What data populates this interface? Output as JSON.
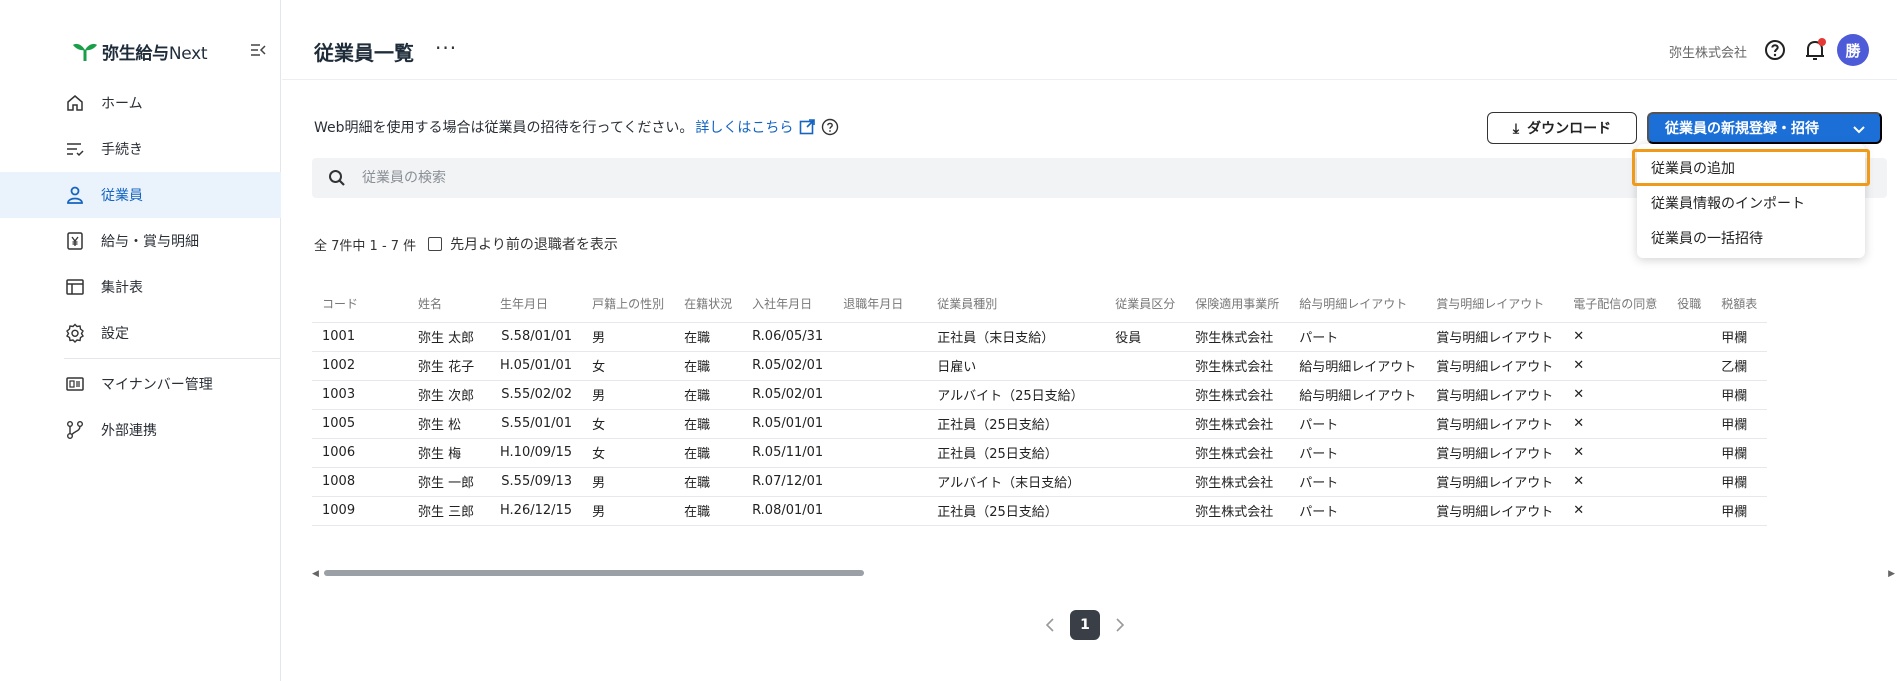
{
  "app": {
    "logo_text": "弥生給与",
    "logo_suffix": "Next",
    "colors": {
      "accent": "#1b6fd6",
      "active_bg": "#eaf2fb",
      "avatar": "#4d5bd8",
      "highlight": "#f09a1a"
    }
  },
  "sidebar": {
    "items": [
      {
        "label": "ホーム",
        "icon": "home-icon"
      },
      {
        "label": "手続き",
        "icon": "procedures-icon"
      },
      {
        "label": "従業員",
        "icon": "person-icon",
        "active": true
      },
      {
        "label": "給与・賞与明細",
        "icon": "yen-icon"
      },
      {
        "label": "集計表",
        "icon": "table-icon"
      },
      {
        "label": "設定",
        "icon": "gear-icon"
      },
      {
        "label": "マイナンバー管理",
        "icon": "id-card-icon"
      },
      {
        "label": "外部連携",
        "icon": "integration-icon"
      }
    ]
  },
  "header": {
    "title": "従業員一覧",
    "more": "···",
    "company": "弥生株式会社",
    "avatar_initial": "勝"
  },
  "main": {
    "notice_text": "Web明細を使用する場合は従業員の招待を行ってください。",
    "notice_link": "詳しくはこちら",
    "download_label": "ダウンロード",
    "register_label": "従業員の新規登録・招待",
    "search_placeholder": "従業員の検索",
    "count_text": "全 7件中 1 - 7 件",
    "show_retired_label": "先月より前の退職者を表示"
  },
  "table": {
    "columns": [
      "コード",
      "姓名",
      "生年月日",
      "戸籍上の性別",
      "在籍状況",
      "入社年月日",
      "退職年月日",
      "従業員種別",
      "従業員区分",
      "保険適用事業所",
      "給与明細レイアウト",
      "賞与明細レイアウト",
      "電子配信の同意",
      "役職",
      "税額表"
    ],
    "rows": [
      [
        "1001",
        "弥生 太郎",
        "S.58/01/01",
        "男",
        "在職",
        "R.06/05/31",
        "",
        "正社員（末日支給）",
        "役員",
        "弥生株式会社",
        "パート",
        "賞与明細レイアウト",
        "✕",
        "",
        "甲欄"
      ],
      [
        "1002",
        "弥生 花子",
        "H.05/01/01",
        "女",
        "在職",
        "R.05/02/01",
        "",
        "日雇い",
        "",
        "弥生株式会社",
        "給与明細レイアウト",
        "賞与明細レイアウト",
        "✕",
        "",
        "乙欄"
      ],
      [
        "1003",
        "弥生 次郎",
        "S.55/02/02",
        "男",
        "在職",
        "R.05/02/01",
        "",
        "アルバイト（25日支給）",
        "",
        "弥生株式会社",
        "給与明細レイアウト",
        "賞与明細レイアウト",
        "✕",
        "",
        "甲欄"
      ],
      [
        "1005",
        "弥生 松",
        "S.55/01/01",
        "女",
        "在職",
        "R.05/01/01",
        "",
        "正社員（25日支給）",
        "",
        "弥生株式会社",
        "パート",
        "賞与明細レイアウト",
        "✕",
        "",
        "甲欄"
      ],
      [
        "1006",
        "弥生 梅",
        "H.10/09/15",
        "女",
        "在職",
        "R.05/11/01",
        "",
        "正社員（25日支給）",
        "",
        "弥生株式会社",
        "パート",
        "賞与明細レイアウト",
        "✕",
        "",
        "甲欄"
      ],
      [
        "1008",
        "弥生 一郎",
        "S.55/09/13",
        "男",
        "在職",
        "R.07/12/01",
        "",
        "アルバイト（末日支給）",
        "",
        "弥生株式会社",
        "パート",
        "賞与明細レイアウト",
        "✕",
        "",
        "甲欄"
      ],
      [
        "1009",
        "弥生 三郎",
        "H.26/12/15",
        "男",
        "在職",
        "R.08/01/01",
        "",
        "正社員（25日支給）",
        "",
        "弥生株式会社",
        "パート",
        "賞与明細レイアウト",
        "✕",
        "",
        "甲欄"
      ]
    ]
  },
  "pagination": {
    "current": "1"
  },
  "dropdown": {
    "items": [
      "従業員の追加",
      "従業員情報のインポート",
      "従業員の一括招待"
    ]
  }
}
